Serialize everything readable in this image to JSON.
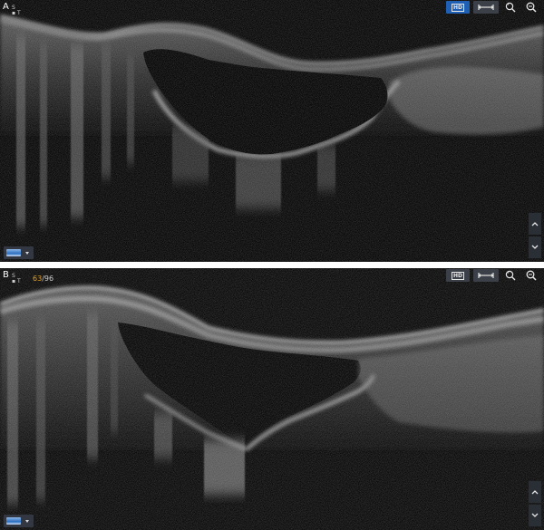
{
  "panels": [
    {
      "letter": "A",
      "orientation_marker": "S\n▪ T",
      "toolbar": {
        "hd_label": "HD",
        "hd_active": true
      },
      "icons": [
        "hd-icon",
        "caliper-icon",
        "search-eye-icon",
        "zoom-icon",
        "chevron-up-icon",
        "chevron-down-icon",
        "thumbnail-icon",
        "caret-down-icon"
      ]
    },
    {
      "letter": "B",
      "orientation_marker": "S\n▪ T",
      "frame_counter": {
        "current": "63",
        "total": "/96"
      },
      "toolbar": {
        "hd_label": "HD",
        "hd_active": false
      },
      "icons": [
        "hd-icon",
        "caliper-icon",
        "search-eye-icon",
        "zoom-icon",
        "chevron-up-icon",
        "chevron-down-icon",
        "thumbnail-icon",
        "caret-down-icon"
      ]
    }
  ],
  "colors": {
    "active_button": "#1f5fb4",
    "counter_accent": "#e8a320",
    "background": "#050505"
  }
}
